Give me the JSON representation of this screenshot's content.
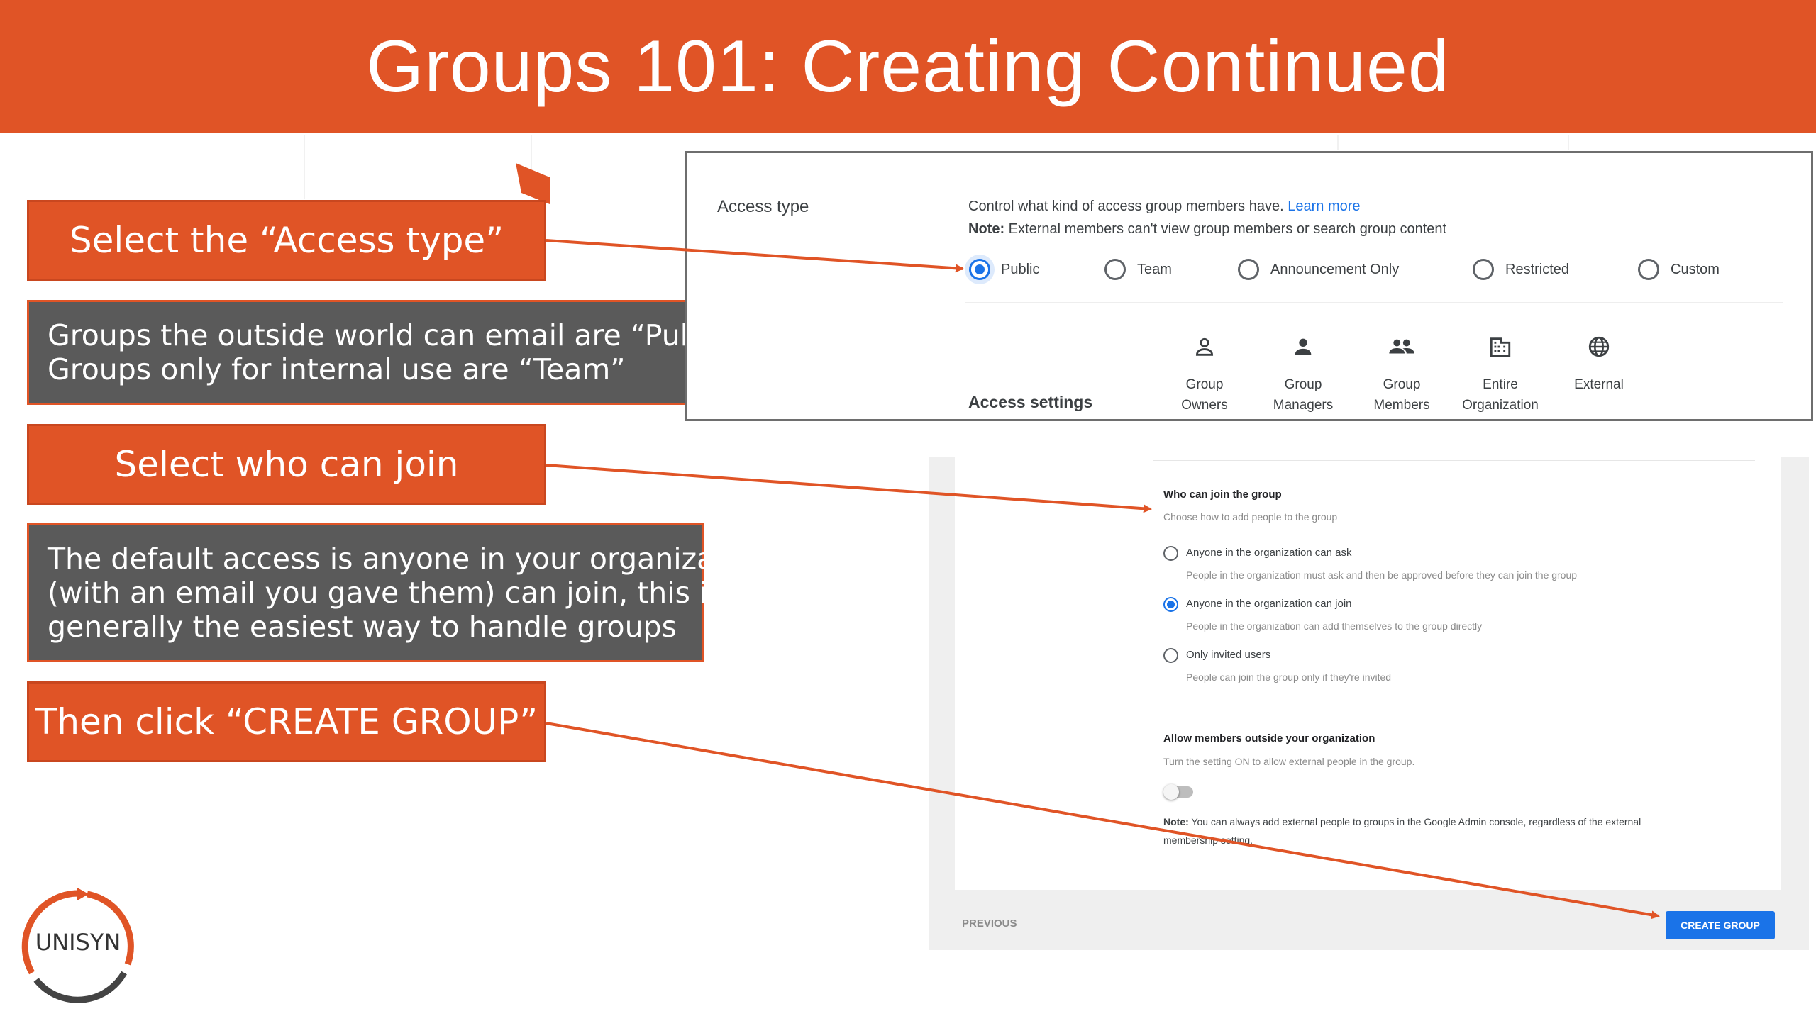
{
  "slide": {
    "title": "Groups 101: Creating Continued"
  },
  "callouts": {
    "access_type": "Select the “Access type”",
    "public_team_lines": [
      "Groups the outside world can email are “Public”",
      "Groups only for internal use are “Team”"
    ],
    "who_can_join": "Select who can join",
    "default_access_lines": [
      "The default access is anyone in your organization",
      "(with an email you gave them) can join, this is",
      "generally the easiest way to handle groups"
    ],
    "create_group": "Then click “CREATE GROUP”"
  },
  "access_panel": {
    "label": "Access type",
    "description": "Control what kind of access group members have.",
    "learn_more": "Learn more",
    "note_prefix": "Note:",
    "note_text": "External members can't view group members or search group content",
    "options": [
      {
        "label": "Public",
        "selected": true
      },
      {
        "label": "Team",
        "selected": false
      },
      {
        "label": "Announcement Only",
        "selected": false
      },
      {
        "label": "Restricted",
        "selected": false
      },
      {
        "label": "Custom",
        "selected": false
      }
    ],
    "access_settings_label": "Access settings",
    "permission_columns": [
      {
        "icon": "person-outline-icon",
        "line1": "Group",
        "line2": "Owners"
      },
      {
        "icon": "person-icon",
        "line1": "Group",
        "line2": "Managers"
      },
      {
        "icon": "people-icon",
        "line1": "Group",
        "line2": "Members"
      },
      {
        "icon": "building-icon",
        "line1": "Entire",
        "line2": "Organization"
      },
      {
        "icon": "globe-icon",
        "line1": "External",
        "line2": ""
      }
    ]
  },
  "join_panel": {
    "title": "Who can join the group",
    "subtitle": "Choose how to add people to the group",
    "options": [
      {
        "label": "Anyone in the organization can ask",
        "desc": "People in the organization must ask and then be approved before they can join the group",
        "selected": false
      },
      {
        "label": "Anyone in the organization can join",
        "desc": "People in the organization can add themselves to the group directly",
        "selected": true
      },
      {
        "label": "Only invited users",
        "desc": "People can join the group only if they're invited",
        "selected": false
      }
    ],
    "external_title": "Allow members outside your organization",
    "external_desc": "Turn the setting ON to allow external people in the group.",
    "external_toggle_on": false,
    "note_prefix": "Note:",
    "note_line1": "You can always add external people to groups in the Google Admin console, regardless of the external",
    "note_line2": "membership setting.",
    "previous_label": "PREVIOUS",
    "create_label": "CREATE GROUP"
  },
  "logo": {
    "text": "UNISYN"
  },
  "colors": {
    "brand_orange": "#e05426",
    "callout_gray": "#5a5a5a",
    "google_blue": "#1a73e8"
  }
}
